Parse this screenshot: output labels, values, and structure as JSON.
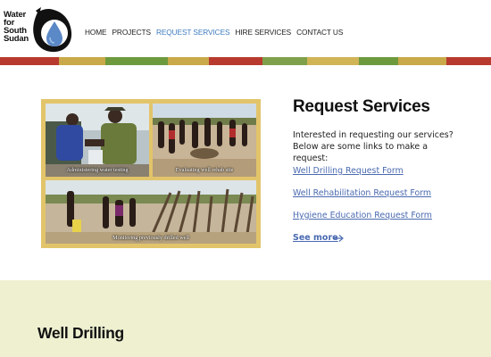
{
  "logo": {
    "text_lines": [
      "Water",
      "for",
      "South",
      "Sudan"
    ]
  },
  "nav": {
    "items": [
      {
        "label": "HOME",
        "active": false
      },
      {
        "label": "PROJECTS",
        "active": false
      },
      {
        "label": "REQUEST SERVICES",
        "active": true
      },
      {
        "label": "HIRE SERVICES",
        "active": false
      },
      {
        "label": "CONTACT US",
        "active": false
      }
    ]
  },
  "colors": {
    "accent_link": "#4a6ab0",
    "nav_active": "#3e7bbf",
    "stripe": [
      "#b83a2e",
      "#c9a949",
      "#6e9a3e",
      "#c9a949",
      "#b83a2e",
      "#7fa04a",
      "#d0b456",
      "#6e9a3e",
      "#c9a949",
      "#b83a2e"
    ],
    "photo_frame": "#e2c46a",
    "lower_bg": "#eef0d0"
  },
  "photos": {
    "captions": [
      "Administering water testing",
      "Evaluating well rehab site",
      "Monitoring previously drilled well"
    ]
  },
  "request_services": {
    "title": "Request Services",
    "intro": "Interested in requesting our services? Below are some links to make a request:",
    "links": [
      "Well Drilling Request Form",
      "Well Rehabilitation Request Form",
      "Hygiene Education Request Form"
    ],
    "see_more": "See more",
    "see_more_icon": "arrow-right-icon"
  },
  "lower_section": {
    "title": "Well Drilling"
  }
}
